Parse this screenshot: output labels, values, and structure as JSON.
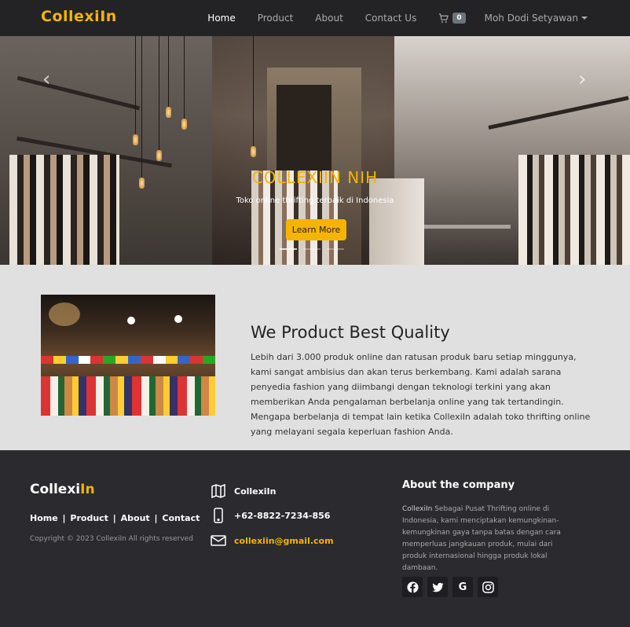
{
  "navbar": {
    "brand_part1": "Collexi",
    "brand_part2": "In",
    "links": [
      "Home",
      "Product",
      "About",
      "Contact Us"
    ],
    "active": "Home",
    "cart_count": "0",
    "user_name": "Moh Dodi Setyawan"
  },
  "hero": {
    "title": "COLLEXIIN NIH",
    "subtitle": "Toko online thrifting terbaik di Indonesia",
    "button_label": "Learn More"
  },
  "about": {
    "heading": "We Product Best Quality",
    "paragraph": "Lebih dari 3.000 produk online dan ratusan produk baru setiap minggunya, kami sangat ambisius dan akan terus berkembang. Kami adalah sarana penyedia fashion yang diimbangi dengan teknologi terkini yang akan memberikan Anda pengalaman berbelanja online yang tak tertandingin. Mengapa berbelanja di tempat lain ketika CollexiIn adalah toko thrifting online yang melayani segala keperluan fashion Anda."
  },
  "footer": {
    "brand_part1": "Collexi",
    "brand_part2": "In",
    "links": [
      "Home",
      "Product",
      "About",
      "Contact"
    ],
    "separator": "|",
    "copyright": "Copyright © 2023 CollexiIn All rights reserved",
    "contact_name": "CollexiIn",
    "contact_phone": "+62-8822-7234-856",
    "contact_email": "collexiin@gmail.com",
    "about_heading": "About the company",
    "about_brand": "CollexiIn",
    "about_text": " Sebagai Pusat Thrifting online di Indonesia, kami menciptakan kemungkinan-kemungkinan gaya tanpa batas dengan cara memperluas jangkauan produk, mulai dari produk internasional hingga produk lokal dambaan.",
    "socials": [
      "facebook-icon",
      "twitter-icon",
      "google-icon",
      "instagram-icon"
    ]
  },
  "colors": {
    "accent": "#f4b400",
    "navbar_bg": "#232326",
    "footer_bg": "#2b2a2e",
    "section_bg": "#e0e0e0"
  }
}
